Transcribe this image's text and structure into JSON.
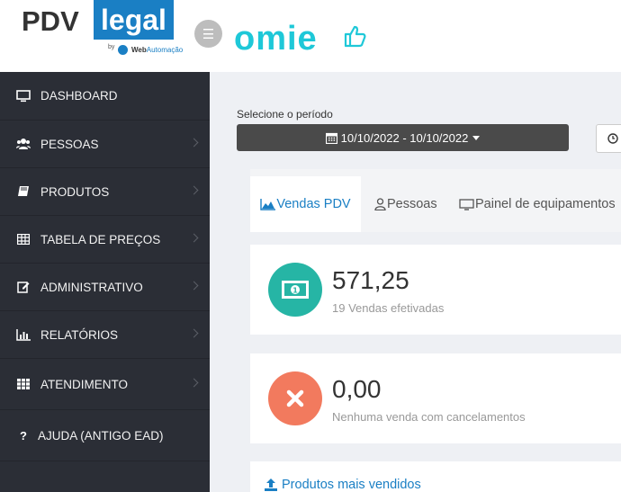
{
  "header": {
    "logo_main": "PDV",
    "logo_highlight": "legal",
    "logo_by": "by",
    "logo_company_a": "Web",
    "logo_company_b": "Automação",
    "partner_logo": "omie"
  },
  "sidebar": {
    "items": [
      {
        "label": "DASHBOARD",
        "icon": "monitor-icon"
      },
      {
        "label": "PESSOAS",
        "icon": "users-icon"
      },
      {
        "label": "PRODUTOS",
        "icon": "book-icon"
      },
      {
        "label": "TABELA DE PREÇOS",
        "icon": "table-icon"
      },
      {
        "label": "ADMINISTRATIVO",
        "icon": "edit-icon"
      },
      {
        "label": "RELATÓRIOS",
        "icon": "bar-chart-icon"
      },
      {
        "label": "ATENDIMENTO",
        "icon": "grid-icon"
      },
      {
        "label": "AJUDA (ANTIGO EAD)",
        "icon": "question-icon"
      }
    ]
  },
  "period": {
    "label": "Selecione o período",
    "value": "10/10/2022 - 10/10/2022"
  },
  "tabs": [
    {
      "label": "Vendas PDV",
      "active": true
    },
    {
      "label": "Pessoas",
      "active": false
    },
    {
      "label": "Painel de equipamentos",
      "active": false
    }
  ],
  "cards": {
    "sales": {
      "value": "571,25",
      "subtitle": "19 Vendas efetivadas",
      "color": "#26b5a5"
    },
    "cancel": {
      "value": "0,00",
      "subtitle": "Nenhuma venda com cancelamentos",
      "color": "#f27a5e"
    }
  },
  "products": {
    "title": "Produtos mais vendidos"
  },
  "colors": {
    "accent": "#1a7fc4",
    "sidebar": "#2b2e36",
    "omie": "#1ec8d8"
  }
}
